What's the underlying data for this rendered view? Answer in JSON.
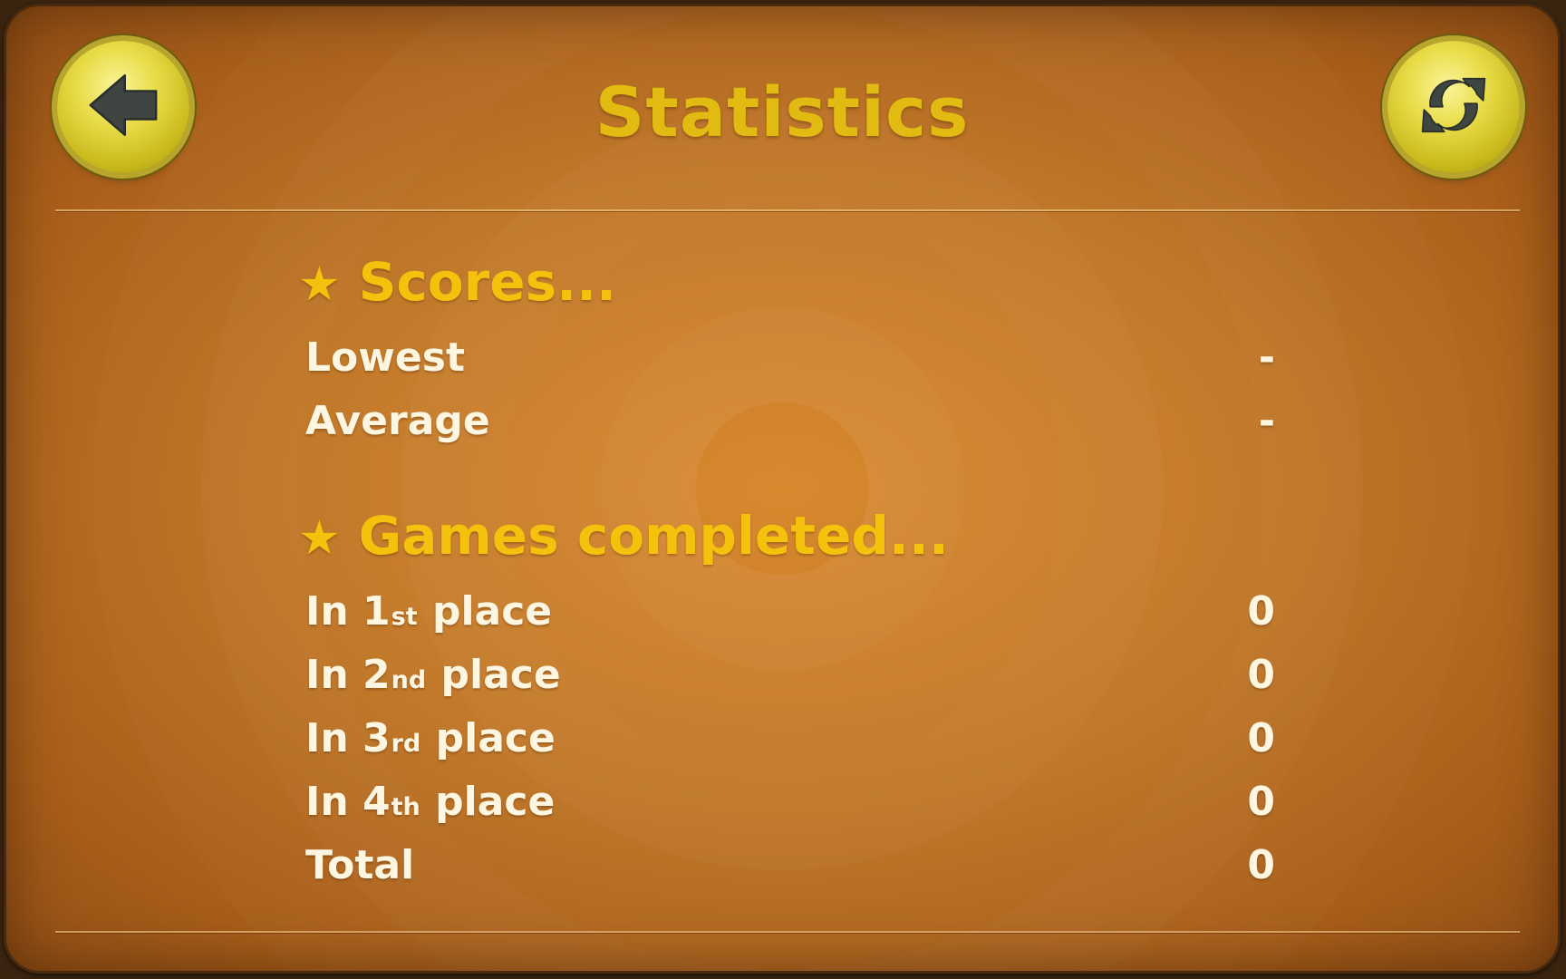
{
  "header": {
    "title": "Statistics",
    "back_icon": "back-arrow-icon",
    "refresh_icon": "refresh-icon"
  },
  "scores": {
    "heading": "Scores...",
    "star": "★",
    "rows": [
      {
        "label": "Lowest",
        "value": "-"
      },
      {
        "label": "Average",
        "value": "-"
      }
    ]
  },
  "games": {
    "heading": "Games completed...",
    "star": "★",
    "rows": [
      {
        "prefix": "In 1",
        "suffix": "st",
        "rest": " place",
        "value": "0"
      },
      {
        "prefix": "In 2",
        "suffix": "nd",
        "rest": " place",
        "value": "0"
      },
      {
        "prefix": "In 3",
        "suffix": "rd",
        "rest": " place",
        "value": "0"
      },
      {
        "prefix": "In 4",
        "suffix": "th",
        "rest": " place",
        "value": "0"
      }
    ],
    "total": {
      "label": "Total",
      "value": "0"
    }
  },
  "colors": {
    "title": "#e2bb12",
    "heading": "#f4c10d",
    "row_text": "#fff6e2",
    "panel": "#c07626",
    "button": "#e8dc48"
  }
}
